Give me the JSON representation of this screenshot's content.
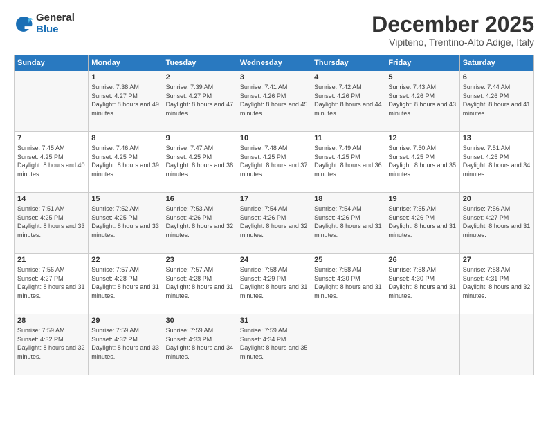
{
  "logo": {
    "general": "General",
    "blue": "Blue"
  },
  "title": "December 2025",
  "subtitle": "Vipiteno, Trentino-Alto Adige, Italy",
  "days_header": [
    "Sunday",
    "Monday",
    "Tuesday",
    "Wednesday",
    "Thursday",
    "Friday",
    "Saturday"
  ],
  "weeks": [
    [
      {
        "day": "",
        "sunrise": "",
        "sunset": "",
        "daylight": ""
      },
      {
        "day": "1",
        "sunrise": "Sunrise: 7:38 AM",
        "sunset": "Sunset: 4:27 PM",
        "daylight": "Daylight: 8 hours and 49 minutes."
      },
      {
        "day": "2",
        "sunrise": "Sunrise: 7:39 AM",
        "sunset": "Sunset: 4:27 PM",
        "daylight": "Daylight: 8 hours and 47 minutes."
      },
      {
        "day": "3",
        "sunrise": "Sunrise: 7:41 AM",
        "sunset": "Sunset: 4:26 PM",
        "daylight": "Daylight: 8 hours and 45 minutes."
      },
      {
        "day": "4",
        "sunrise": "Sunrise: 7:42 AM",
        "sunset": "Sunset: 4:26 PM",
        "daylight": "Daylight: 8 hours and 44 minutes."
      },
      {
        "day": "5",
        "sunrise": "Sunrise: 7:43 AM",
        "sunset": "Sunset: 4:26 PM",
        "daylight": "Daylight: 8 hours and 43 minutes."
      },
      {
        "day": "6",
        "sunrise": "Sunrise: 7:44 AM",
        "sunset": "Sunset: 4:26 PM",
        "daylight": "Daylight: 8 hours and 41 minutes."
      }
    ],
    [
      {
        "day": "7",
        "sunrise": "Sunrise: 7:45 AM",
        "sunset": "Sunset: 4:25 PM",
        "daylight": "Daylight: 8 hours and 40 minutes."
      },
      {
        "day": "8",
        "sunrise": "Sunrise: 7:46 AM",
        "sunset": "Sunset: 4:25 PM",
        "daylight": "Daylight: 8 hours and 39 minutes."
      },
      {
        "day": "9",
        "sunrise": "Sunrise: 7:47 AM",
        "sunset": "Sunset: 4:25 PM",
        "daylight": "Daylight: 8 hours and 38 minutes."
      },
      {
        "day": "10",
        "sunrise": "Sunrise: 7:48 AM",
        "sunset": "Sunset: 4:25 PM",
        "daylight": "Daylight: 8 hours and 37 minutes."
      },
      {
        "day": "11",
        "sunrise": "Sunrise: 7:49 AM",
        "sunset": "Sunset: 4:25 PM",
        "daylight": "Daylight: 8 hours and 36 minutes."
      },
      {
        "day": "12",
        "sunrise": "Sunrise: 7:50 AM",
        "sunset": "Sunset: 4:25 PM",
        "daylight": "Daylight: 8 hours and 35 minutes."
      },
      {
        "day": "13",
        "sunrise": "Sunrise: 7:51 AM",
        "sunset": "Sunset: 4:25 PM",
        "daylight": "Daylight: 8 hours and 34 minutes."
      }
    ],
    [
      {
        "day": "14",
        "sunrise": "Sunrise: 7:51 AM",
        "sunset": "Sunset: 4:25 PM",
        "daylight": "Daylight: 8 hours and 33 minutes."
      },
      {
        "day": "15",
        "sunrise": "Sunrise: 7:52 AM",
        "sunset": "Sunset: 4:25 PM",
        "daylight": "Daylight: 8 hours and 33 minutes."
      },
      {
        "day": "16",
        "sunrise": "Sunrise: 7:53 AM",
        "sunset": "Sunset: 4:26 PM",
        "daylight": "Daylight: 8 hours and 32 minutes."
      },
      {
        "day": "17",
        "sunrise": "Sunrise: 7:54 AM",
        "sunset": "Sunset: 4:26 PM",
        "daylight": "Daylight: 8 hours and 32 minutes."
      },
      {
        "day": "18",
        "sunrise": "Sunrise: 7:54 AM",
        "sunset": "Sunset: 4:26 PM",
        "daylight": "Daylight: 8 hours and 31 minutes."
      },
      {
        "day": "19",
        "sunrise": "Sunrise: 7:55 AM",
        "sunset": "Sunset: 4:26 PM",
        "daylight": "Daylight: 8 hours and 31 minutes."
      },
      {
        "day": "20",
        "sunrise": "Sunrise: 7:56 AM",
        "sunset": "Sunset: 4:27 PM",
        "daylight": "Daylight: 8 hours and 31 minutes."
      }
    ],
    [
      {
        "day": "21",
        "sunrise": "Sunrise: 7:56 AM",
        "sunset": "Sunset: 4:27 PM",
        "daylight": "Daylight: 8 hours and 31 minutes."
      },
      {
        "day": "22",
        "sunrise": "Sunrise: 7:57 AM",
        "sunset": "Sunset: 4:28 PM",
        "daylight": "Daylight: 8 hours and 31 minutes."
      },
      {
        "day": "23",
        "sunrise": "Sunrise: 7:57 AM",
        "sunset": "Sunset: 4:28 PM",
        "daylight": "Daylight: 8 hours and 31 minutes."
      },
      {
        "day": "24",
        "sunrise": "Sunrise: 7:58 AM",
        "sunset": "Sunset: 4:29 PM",
        "daylight": "Daylight: 8 hours and 31 minutes."
      },
      {
        "day": "25",
        "sunrise": "Sunrise: 7:58 AM",
        "sunset": "Sunset: 4:30 PM",
        "daylight": "Daylight: 8 hours and 31 minutes."
      },
      {
        "day": "26",
        "sunrise": "Sunrise: 7:58 AM",
        "sunset": "Sunset: 4:30 PM",
        "daylight": "Daylight: 8 hours and 31 minutes."
      },
      {
        "day": "27",
        "sunrise": "Sunrise: 7:58 AM",
        "sunset": "Sunset: 4:31 PM",
        "daylight": "Daylight: 8 hours and 32 minutes."
      }
    ],
    [
      {
        "day": "28",
        "sunrise": "Sunrise: 7:59 AM",
        "sunset": "Sunset: 4:32 PM",
        "daylight": "Daylight: 8 hours and 32 minutes."
      },
      {
        "day": "29",
        "sunrise": "Sunrise: 7:59 AM",
        "sunset": "Sunset: 4:32 PM",
        "daylight": "Daylight: 8 hours and 33 minutes."
      },
      {
        "day": "30",
        "sunrise": "Sunrise: 7:59 AM",
        "sunset": "Sunset: 4:33 PM",
        "daylight": "Daylight: 8 hours and 34 minutes."
      },
      {
        "day": "31",
        "sunrise": "Sunrise: 7:59 AM",
        "sunset": "Sunset: 4:34 PM",
        "daylight": "Daylight: 8 hours and 35 minutes."
      },
      {
        "day": "",
        "sunrise": "",
        "sunset": "",
        "daylight": ""
      },
      {
        "day": "",
        "sunrise": "",
        "sunset": "",
        "daylight": ""
      },
      {
        "day": "",
        "sunrise": "",
        "sunset": "",
        "daylight": ""
      }
    ]
  ]
}
